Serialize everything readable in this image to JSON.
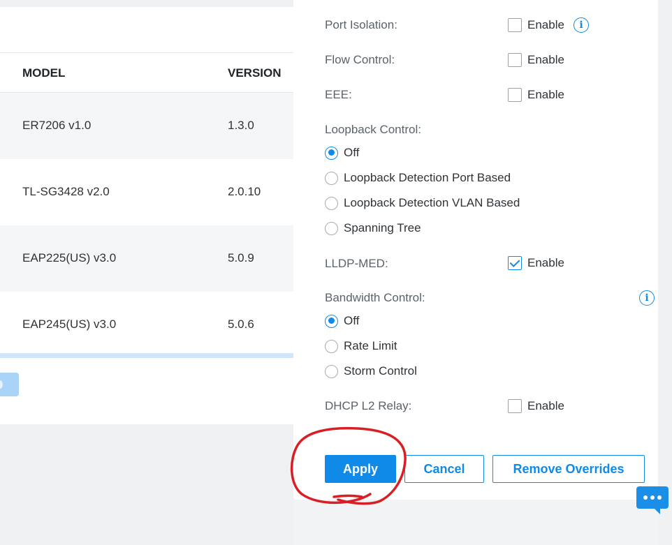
{
  "table": {
    "columns": {
      "model": "MODEL",
      "version": "VERSION"
    },
    "rows": [
      {
        "model": "ER7206 v1.0",
        "version": "1.3.0"
      },
      {
        "model": "TL-SG3428 v2.0",
        "version": "2.0.10"
      },
      {
        "model": "EAP225(US) v3.0",
        "version": "5.0.9"
      },
      {
        "model": "EAP245(US) v3.0",
        "version": "5.0.6"
      }
    ]
  },
  "settings": {
    "port_isolation": {
      "label": "Port Isolation:",
      "checkbox": "Enable",
      "checked": false
    },
    "flow_control": {
      "label": "Flow Control:",
      "checkbox": "Enable",
      "checked": false
    },
    "eee": {
      "label": "EEE:",
      "checkbox": "Enable",
      "checked": false
    },
    "loopback": {
      "label": "Loopback Control:",
      "options": [
        "Off",
        "Loopback Detection Port Based",
        "Loopback Detection VLAN Based",
        "Spanning Tree"
      ],
      "selected": "Off"
    },
    "lldp_med": {
      "label": "LLDP-MED:",
      "checkbox": "Enable",
      "checked": true
    },
    "bandwidth": {
      "label": "Bandwidth Control:",
      "options": [
        "Off",
        "Rate Limit",
        "Storm Control"
      ],
      "selected": "Off"
    },
    "dhcp_relay": {
      "label": "DHCP L2 Relay:",
      "checkbox": "Enable",
      "checked": false
    }
  },
  "buttons": {
    "apply": "Apply",
    "cancel": "Cancel",
    "remove": "Remove Overrides"
  },
  "icons": {
    "info": "info-icon",
    "chat": "chat-bubble-icon"
  },
  "colors": {
    "accent": "#0f8ae8",
    "annotation": "#d91f26"
  }
}
